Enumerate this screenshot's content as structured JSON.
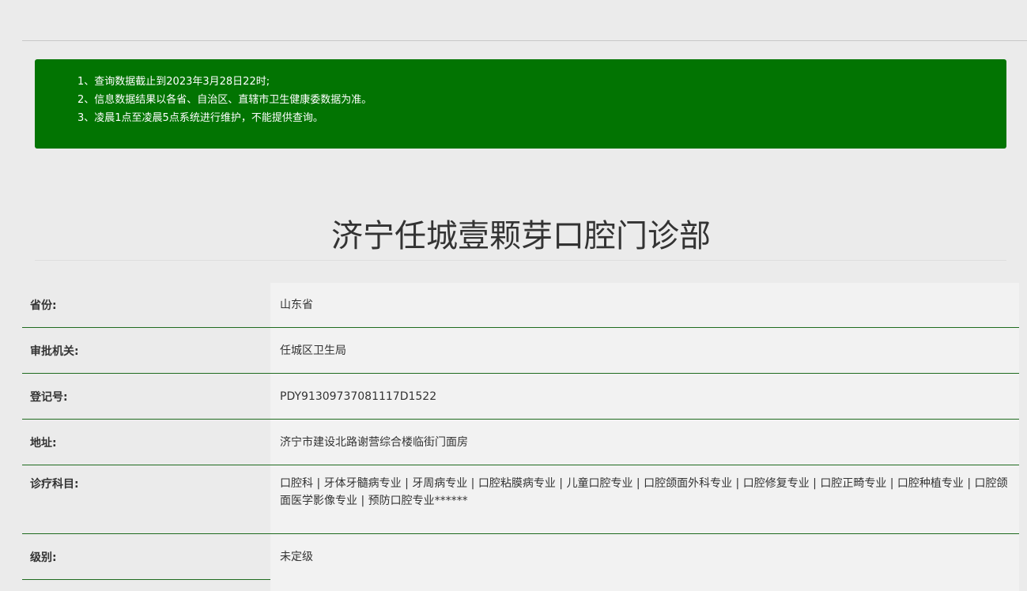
{
  "notice": {
    "lines": [
      "1、查询数据截止到2023年3月28日22时;",
      "2、信息数据结果以各省、自治区、直辖市卫生健康委数据为准。",
      "3、凌晨1点至凌晨5点系统进行维护，不能提供查询。"
    ],
    "background_color": "#027402"
  },
  "title": "济宁任城壹颗芽口腔门诊部",
  "info": [
    {
      "label": "省份:",
      "value": "山东省"
    },
    {
      "label": "审批机关:",
      "value": "任城区卫生局"
    },
    {
      "label": "登记号:",
      "value": "PDY91309737081117D1522"
    },
    {
      "label": "地址:",
      "value": "济宁市建设北路谢营综合楼临街门面房"
    },
    {
      "label": "诊疗科目:",
      "value": "口腔科 | 牙体牙髓病专业 | 牙周病专业 | 口腔粘膜病专业 | 儿童口腔专业 | 口腔颌面外科专业 | 口腔修复专业 | 口腔正畸专业 | 口腔种植专业 | 口腔颌面医学影像专业 | 预防口腔专业******"
    },
    {
      "label": "级别:",
      "value": "未定级"
    }
  ],
  "colors": {
    "row_divider": "#1f6b1f",
    "page_background": "#ebebeb"
  }
}
